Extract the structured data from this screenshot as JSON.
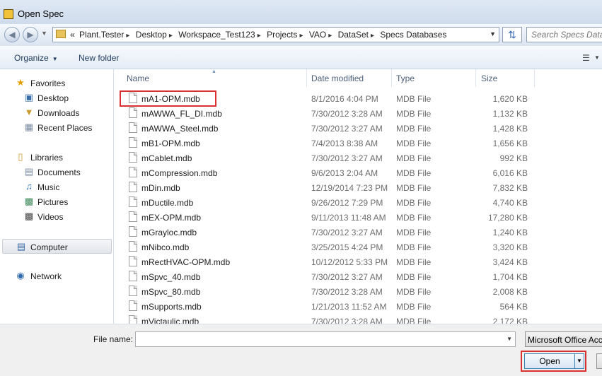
{
  "window": {
    "title": "Open Spec",
    "icon": "app-icon"
  },
  "navigation": {
    "breadcrumbs": [
      "Plant.Tester",
      "Desktop",
      "Workspace_Test123",
      "Projects",
      "VAO",
      "DataSet",
      "Specs Databases"
    ],
    "overflow_marker": "«",
    "search_placeholder": "Search Specs Databases"
  },
  "toolbar": {
    "organize": "Organize",
    "new_folder": "New folder"
  },
  "sidebar": {
    "favorites": {
      "label": "Favorites",
      "items": [
        {
          "label": "Desktop",
          "icon": "desktop-icon"
        },
        {
          "label": "Downloads",
          "icon": "downloads-icon"
        },
        {
          "label": "Recent Places",
          "icon": "recent-places-icon"
        }
      ]
    },
    "libraries": {
      "label": "Libraries",
      "items": [
        {
          "label": "Documents",
          "icon": "documents-icon"
        },
        {
          "label": "Music",
          "icon": "music-icon"
        },
        {
          "label": "Pictures",
          "icon": "pictures-icon"
        },
        {
          "label": "Videos",
          "icon": "videos-icon"
        }
      ]
    },
    "computer": {
      "label": "Computer"
    },
    "network": {
      "label": "Network"
    }
  },
  "file_list": {
    "columns": {
      "name": "Name",
      "date": "Date modified",
      "type": "Type",
      "size": "Size"
    },
    "files": [
      {
        "name": "mA1-OPM.mdb",
        "date": "8/1/2016 4:04 PM",
        "type": "MDB File",
        "size": "1,620 KB"
      },
      {
        "name": "mAWWA_FL_DI.mdb",
        "date": "7/30/2012 3:28 AM",
        "type": "MDB File",
        "size": "1,132 KB"
      },
      {
        "name": "mAWWA_Steel.mdb",
        "date": "7/30/2012 3:27 AM",
        "type": "MDB File",
        "size": "1,428 KB"
      },
      {
        "name": "mB1-OPM.mdb",
        "date": "7/4/2013 8:38 AM",
        "type": "MDB File",
        "size": "1,656 KB"
      },
      {
        "name": "mCablet.mdb",
        "date": "7/30/2012 3:27 AM",
        "type": "MDB File",
        "size": "992 KB"
      },
      {
        "name": "mCompression.mdb",
        "date": "9/6/2013 2:04 AM",
        "type": "MDB File",
        "size": "6,016 KB"
      },
      {
        "name": "mDin.mdb",
        "date": "12/19/2014 7:23 PM",
        "type": "MDB File",
        "size": "7,832 KB"
      },
      {
        "name": "mDuctile.mdb",
        "date": "9/26/2012 7:29 PM",
        "type": "MDB File",
        "size": "4,740 KB"
      },
      {
        "name": "mEX-OPM.mdb",
        "date": "9/11/2013 11:48 AM",
        "type": "MDB File",
        "size": "17,280 KB"
      },
      {
        "name": "mGrayloc.mdb",
        "date": "7/30/2012 3:27 AM",
        "type": "MDB File",
        "size": "1,240 KB"
      },
      {
        "name": "mNibco.mdb",
        "date": "3/25/2015 4:24 PM",
        "type": "MDB File",
        "size": "3,320 KB"
      },
      {
        "name": "mRectHVAC-OPM.mdb",
        "date": "10/12/2012 5:33 PM",
        "type": "MDB File",
        "size": "3,424 KB"
      },
      {
        "name": "mSpvc_40.mdb",
        "date": "7/30/2012 3:27 AM",
        "type": "MDB File",
        "size": "1,704 KB"
      },
      {
        "name": "mSpvc_80.mdb",
        "date": "7/30/2012 3:28 AM",
        "type": "MDB File",
        "size": "2,008 KB"
      },
      {
        "name": "mSupports.mdb",
        "date": "1/21/2013 11:52 AM",
        "type": "MDB File",
        "size": "564 KB"
      },
      {
        "name": "mVictaulic.mdb",
        "date": "7/30/2012 3:28 AM",
        "type": "MDB File",
        "size": "2,172 KB"
      }
    ]
  },
  "footer": {
    "file_name_label": "File name:",
    "file_name_value": "",
    "file_type_filter": "Microsoft Office Access",
    "open_button": "Open"
  },
  "colors": {
    "highlight": "#d9312f",
    "accent": "#3c7fb1"
  }
}
